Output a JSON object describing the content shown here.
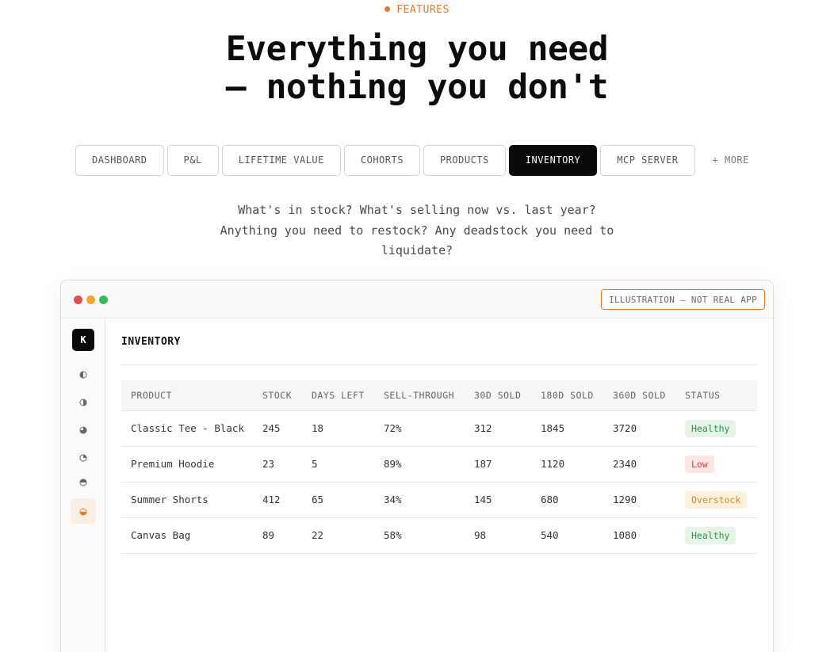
{
  "eyebrow": "FEATURES",
  "headline": {
    "line1": "Everything you need",
    "line2": "— nothing you don't"
  },
  "tabs": [
    {
      "label": "DASHBOARD",
      "active": false
    },
    {
      "label": "P&L",
      "active": false
    },
    {
      "label": "LIFETIME VALUE",
      "active": false
    },
    {
      "label": "COHORTS",
      "active": false
    },
    {
      "label": "PRODUCTS",
      "active": false
    },
    {
      "label": "INVENTORY",
      "active": true
    },
    {
      "label": "MCP SERVER",
      "active": false
    },
    {
      "label": "+ MORE",
      "active": false
    }
  ],
  "description": {
    "line1": "What's in stock? What's selling now vs. last year?",
    "line2": "Anything you need to restock? Any deadstock you need to",
    "line3": "liquidate?"
  },
  "window": {
    "badge": "ILLUSTRATION — NOT REAL APP",
    "logo": "K",
    "sidebar_icons": [
      {
        "glyph": "◐",
        "name": "dashboard-icon",
        "active": false
      },
      {
        "glyph": "◑",
        "name": "pnl-icon",
        "active": false
      },
      {
        "glyph": "◕",
        "name": "lifetime-value-icon",
        "active": false
      },
      {
        "glyph": "◔",
        "name": "cohorts-icon",
        "active": false
      },
      {
        "glyph": "◓",
        "name": "products-icon",
        "active": false
      },
      {
        "glyph": "◒",
        "name": "inventory-icon",
        "active": true
      }
    ],
    "section_title": "INVENTORY",
    "table": {
      "headers": [
        "PRODUCT",
        "STOCK",
        "DAYS LEFT",
        "SELL-THROUGH",
        "30D SOLD",
        "180D SOLD",
        "360D SOLD",
        "STATUS"
      ],
      "rows": [
        {
          "product": "Classic Tee - Black",
          "stock": "245",
          "days_left": "18",
          "sell_through": "72%",
          "sold_30d": "312",
          "sold_180d": "1845",
          "sold_360d": "3720",
          "status": "Healthy"
        },
        {
          "product": "Premium Hoodie",
          "stock": "23",
          "days_left": "5",
          "sell_through": "89%",
          "sold_30d": "187",
          "sold_180d": "1120",
          "sold_360d": "2340",
          "status": "Low"
        },
        {
          "product": "Summer Shorts",
          "stock": "412",
          "days_left": "65",
          "sell_through": "34%",
          "sold_30d": "145",
          "sold_180d": "680",
          "sold_360d": "1290",
          "status": "Overstock"
        },
        {
          "product": "Canvas Bag",
          "stock": "89",
          "days_left": "22",
          "sell_through": "58%",
          "sold_30d": "98",
          "sold_180d": "540",
          "sold_360d": "1080",
          "status": "Healthy"
        }
      ]
    }
  },
  "colors": {
    "accent": "#e8792a",
    "status_healthy": "#2f8f4a",
    "status_low": "#c84848",
    "status_overstock": "#d98a1f"
  }
}
